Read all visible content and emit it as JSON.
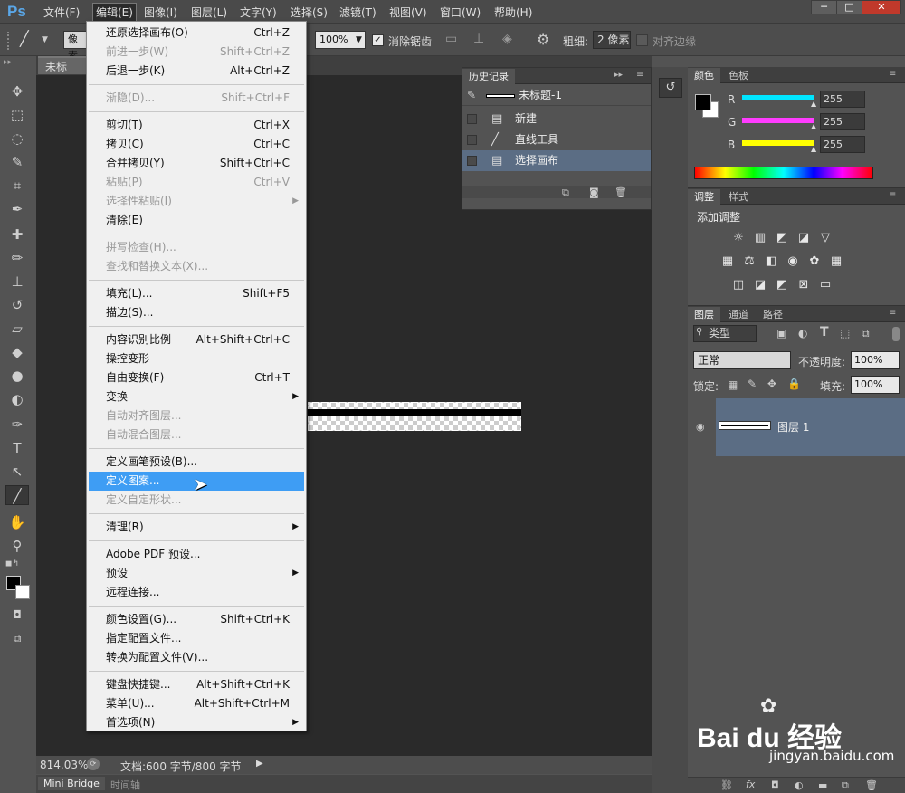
{
  "app": {
    "logo": "Ps"
  },
  "menubar": [
    "文件(F)",
    "编辑(E)",
    "图像(I)",
    "图层(L)",
    "文字(Y)",
    "选择(S)",
    "滤镜(T)",
    "视图(V)",
    "窗口(W)",
    "帮助(H)"
  ],
  "window_controls": [
    "─",
    "□",
    "✕"
  ],
  "options": {
    "mode_label": "像素",
    "opacity": "100%",
    "antialias": "消除锯齿",
    "weight_label": "粗细:",
    "weight_value": "2 像素",
    "align_edges": "对齐边缘"
  },
  "document": {
    "tab": "未标题-1",
    "zoom": "814.03%",
    "doc_info": "文档:600 字节/800 字节"
  },
  "bottom_tabs": [
    "Mini Bridge",
    "时间轴"
  ],
  "history": {
    "title": "历史记录",
    "snapshot": "未标题-1",
    "items": [
      {
        "label": "新建",
        "icon": "doc-icon"
      },
      {
        "label": "直线工具",
        "icon": "line-icon"
      },
      {
        "label": "选择画布",
        "icon": "doc-icon",
        "selected": true
      }
    ]
  },
  "color_panel": {
    "tabs": [
      "颜色",
      "色板"
    ],
    "channels": [
      {
        "name": "R",
        "value": "255",
        "color": "#00e5ff"
      },
      {
        "name": "G",
        "value": "255",
        "color": "#ff3cff"
      },
      {
        "name": "B",
        "value": "255",
        "color": "#ffff00"
      }
    ]
  },
  "adjust_panel": {
    "tabs": [
      "调整",
      "样式"
    ],
    "title": "添加调整"
  },
  "layers_panel": {
    "tabs": [
      "图层",
      "通道",
      "路径"
    ],
    "filter": "类型",
    "blend": "正常",
    "opacity_label": "不透明度:",
    "opacity": "100%",
    "lock_label": "锁定:",
    "fill_label": "填充:",
    "fill": "100%",
    "layer_name": "图层 1"
  },
  "edit_menu": [
    {
      "label": "还原选择画布(O)",
      "shortcut": "Ctrl+Z"
    },
    {
      "label": "前进一步(W)",
      "shortcut": "Shift+Ctrl+Z",
      "disabled": true
    },
    {
      "label": "后退一步(K)",
      "shortcut": "Alt+Ctrl+Z"
    },
    {
      "sep": true
    },
    {
      "label": "渐隐(D)...",
      "shortcut": "Shift+Ctrl+F",
      "disabled": true
    },
    {
      "sep": true
    },
    {
      "label": "剪切(T)",
      "shortcut": "Ctrl+X"
    },
    {
      "label": "拷贝(C)",
      "shortcut": "Ctrl+C"
    },
    {
      "label": "合并拷贝(Y)",
      "shortcut": "Shift+Ctrl+C"
    },
    {
      "label": "粘贴(P)",
      "shortcut": "Ctrl+V",
      "disabled": true
    },
    {
      "label": "选择性粘贴(I)",
      "shortcut": "",
      "disabled": true,
      "submenu": true
    },
    {
      "label": "清除(E)",
      "shortcut": ""
    },
    {
      "sep": true
    },
    {
      "label": "拼写检查(H)...",
      "shortcut": "",
      "disabled": true
    },
    {
      "label": "查找和替换文本(X)...",
      "shortcut": "",
      "disabled": true
    },
    {
      "sep": true
    },
    {
      "label": "填充(L)...",
      "shortcut": "Shift+F5"
    },
    {
      "label": "描边(S)...",
      "shortcut": ""
    },
    {
      "sep": true
    },
    {
      "label": "内容识别比例",
      "shortcut": "Alt+Shift+Ctrl+C"
    },
    {
      "label": "操控变形",
      "shortcut": ""
    },
    {
      "label": "自由变换(F)",
      "shortcut": "Ctrl+T"
    },
    {
      "label": "变换",
      "shortcut": "",
      "submenu": true
    },
    {
      "label": "自动对齐图层...",
      "shortcut": "",
      "disabled": true
    },
    {
      "label": "自动混合图层...",
      "shortcut": "",
      "disabled": true
    },
    {
      "sep": true
    },
    {
      "label": "定义画笔预设(B)...",
      "shortcut": ""
    },
    {
      "label": "定义图案...",
      "shortcut": "",
      "highlighted": true
    },
    {
      "label": "定义自定形状...",
      "shortcut": "",
      "disabled": true
    },
    {
      "sep": true
    },
    {
      "label": "清理(R)",
      "shortcut": "",
      "submenu": true
    },
    {
      "sep": true
    },
    {
      "label": "Adobe PDF 预设...",
      "shortcut": ""
    },
    {
      "label": "预设",
      "shortcut": "",
      "submenu": true
    },
    {
      "label": "远程连接...",
      "shortcut": ""
    },
    {
      "sep": true
    },
    {
      "label": "颜色设置(G)...",
      "shortcut": "Shift+Ctrl+K"
    },
    {
      "label": "指定配置文件...",
      "shortcut": ""
    },
    {
      "label": "转换为配置文件(V)...",
      "shortcut": ""
    },
    {
      "sep": true
    },
    {
      "label": "键盘快捷键...",
      "shortcut": "Alt+Shift+Ctrl+K"
    },
    {
      "label": "菜单(U)...",
      "shortcut": "Alt+Shift+Ctrl+M"
    },
    {
      "label": "首选项(N)",
      "shortcut": "",
      "submenu": true
    }
  ],
  "watermark": {
    "brand": "Bai du 经验",
    "url": "jingyan.baidu.com"
  }
}
